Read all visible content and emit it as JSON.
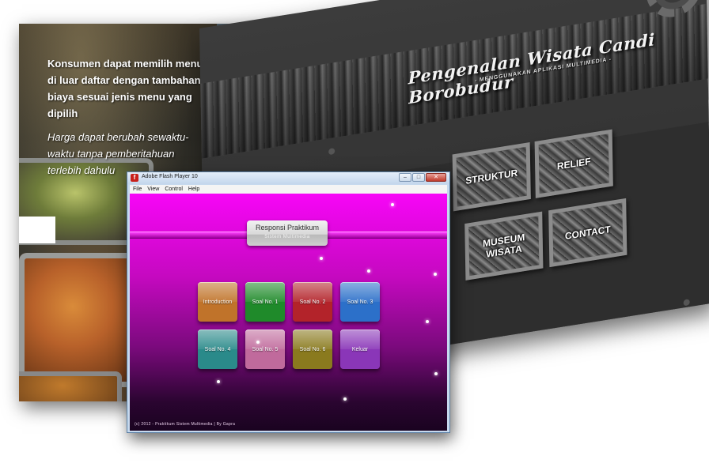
{
  "food_panel": {
    "text_1": "Konsumen dapat memilih menu di luar daftar dengan tambahan biaya sesuai jenis menu yang dipilih",
    "text_2": "Harga dapat berubah sewaktu-waktu tanpa pemberitahuan terlebih dahulu",
    "logo_icon": "cloud-icon"
  },
  "borobudur_panel": {
    "title": "Pengenalan Wisata Candi Borobudur",
    "subtitle": "- MENGGUNAKAN APLIKASI MULTIMEDIA -",
    "buttons": [
      {
        "label": "STRUKTUR"
      },
      {
        "label": "RELIEF"
      },
      {
        "label": "MUSEUM WISATA"
      },
      {
        "label": "CONTACT"
      }
    ],
    "gear_icon": "gear-icon"
  },
  "flash_window": {
    "title": "Adobe Flash Player 10",
    "menu": [
      "File",
      "View",
      "Control",
      "Help"
    ],
    "controls": {
      "minimize": "–",
      "maximize": "□",
      "close": "✕"
    },
    "header": {
      "title": "Responsi Praktikum",
      "subtitle": "Sistem Multimedia"
    },
    "buttons": [
      {
        "label": "Introduction",
        "color": "#c0732a"
      },
      {
        "label": "Soal No. 1",
        "color": "#1f8a2a"
      },
      {
        "label": "Soal No. 2",
        "color": "#b3232a"
      },
      {
        "label": "Soal No. 3",
        "color": "#2c70c9"
      },
      {
        "label": "Soal No. 4",
        "color": "#2a8a8a"
      },
      {
        "label": "Soal No. 5",
        "color": "#c06a9c"
      },
      {
        "label": "Soal No. 6",
        "color": "#8a7a1e"
      },
      {
        "label": "Keluar",
        "color": "#8a36b8"
      }
    ],
    "footer": "(c) 2012 - Praktikum Sistem Multimedia | By Gapra"
  }
}
